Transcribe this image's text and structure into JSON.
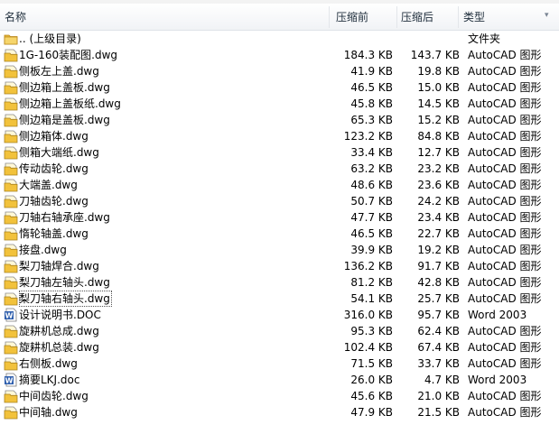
{
  "columns": {
    "name": "名称",
    "compressed": "压缩前",
    "uncompressed": "压缩后",
    "type": "类型"
  },
  "colors": {
    "folder": "#e8b93a",
    "doc": "#2f5fad"
  },
  "parent": {
    "name": ".. (上级目录)",
    "type": "文件夹"
  },
  "rows": [
    {
      "name": "1G-160装配图.dwg",
      "c": "184.3 KB",
      "u": "143.7 KB",
      "type": "AutoCAD 图形",
      "icon": "dwg-file-icon"
    },
    {
      "name": "侧板左上盖.dwg",
      "c": "41.9 KB",
      "u": "19.8 KB",
      "type": "AutoCAD 图形",
      "icon": "dwg-file-icon"
    },
    {
      "name": "侧边箱上盖板.dwg",
      "c": "46.5 KB",
      "u": "15.0 KB",
      "type": "AutoCAD 图形",
      "icon": "dwg-file-icon"
    },
    {
      "name": "侧边箱上盖板纸.dwg",
      "c": "45.8 KB",
      "u": "14.5 KB",
      "type": "AutoCAD 图形",
      "icon": "dwg-file-icon"
    },
    {
      "name": "侧边箱是盖板.dwg",
      "c": "65.3 KB",
      "u": "15.2 KB",
      "type": "AutoCAD 图形",
      "icon": "dwg-file-icon"
    },
    {
      "name": "侧边箱体.dwg",
      "c": "123.2 KB",
      "u": "84.8 KB",
      "type": "AutoCAD 图形",
      "icon": "dwg-file-icon"
    },
    {
      "name": "侧箱大端纸.dwg",
      "c": "33.4 KB",
      "u": "12.7 KB",
      "type": "AutoCAD 图形",
      "icon": "dwg-file-icon"
    },
    {
      "name": "传动齿轮.dwg",
      "c": "63.2 KB",
      "u": "23.2 KB",
      "type": "AutoCAD 图形",
      "icon": "dwg-file-icon"
    },
    {
      "name": "大端盖.dwg",
      "c": "48.6 KB",
      "u": "23.6 KB",
      "type": "AutoCAD 图形",
      "icon": "dwg-file-icon"
    },
    {
      "name": "刀轴齿轮.dwg",
      "c": "50.7 KB",
      "u": "24.2 KB",
      "type": "AutoCAD 图形",
      "icon": "dwg-file-icon"
    },
    {
      "name": "刀轴右轴承座.dwg",
      "c": "47.7 KB",
      "u": "23.4 KB",
      "type": "AutoCAD 图形",
      "icon": "dwg-file-icon"
    },
    {
      "name": "惰轮轴盖.dwg",
      "c": "46.5 KB",
      "u": "22.7 KB",
      "type": "AutoCAD 图形",
      "icon": "dwg-file-icon"
    },
    {
      "name": "接盘.dwg",
      "c": "39.9 KB",
      "u": "19.2 KB",
      "type": "AutoCAD 图形",
      "icon": "dwg-file-icon"
    },
    {
      "name": "梨刀轴焊合.dwg",
      "c": "136.2 KB",
      "u": "91.7 KB",
      "type": "AutoCAD 图形",
      "icon": "dwg-file-icon"
    },
    {
      "name": "梨刀轴左轴头.dwg",
      "c": "81.2 KB",
      "u": "42.8 KB",
      "type": "AutoCAD 图形",
      "icon": "dwg-file-icon"
    },
    {
      "name": "梨刀轴右轴头.dwg",
      "c": "54.1 KB",
      "u": "25.7 KB",
      "type": "AutoCAD 图形",
      "icon": "dwg-file-icon",
      "focus": true
    },
    {
      "name": "设计说明书.DOC",
      "c": "316.0 KB",
      "u": "95.7 KB",
      "type": "Word 2003",
      "icon": "word-file-icon"
    },
    {
      "name": "旋耕机总成.dwg",
      "c": "95.3 KB",
      "u": "62.4 KB",
      "type": "AutoCAD 图形",
      "icon": "dwg-file-icon"
    },
    {
      "name": "旋耕机总装.dwg",
      "c": "102.4 KB",
      "u": "67.4 KB",
      "type": "AutoCAD 图形",
      "icon": "dwg-file-icon"
    },
    {
      "name": "右侧板.dwg",
      "c": "71.5 KB",
      "u": "33.7 KB",
      "type": "AutoCAD 图形",
      "icon": "dwg-file-icon"
    },
    {
      "name": "摘要LKJ.doc",
      "c": "26.0 KB",
      "u": "4.7 KB",
      "type": "Word 2003",
      "icon": "word-file-icon"
    },
    {
      "name": "中间齿轮.dwg",
      "c": "45.6 KB",
      "u": "21.0 KB",
      "type": "AutoCAD 图形",
      "icon": "dwg-file-icon"
    },
    {
      "name": "中间轴.dwg",
      "c": "47.9 KB",
      "u": "21.5 KB",
      "type": "AutoCAD 图形",
      "icon": "dwg-file-icon"
    }
  ]
}
